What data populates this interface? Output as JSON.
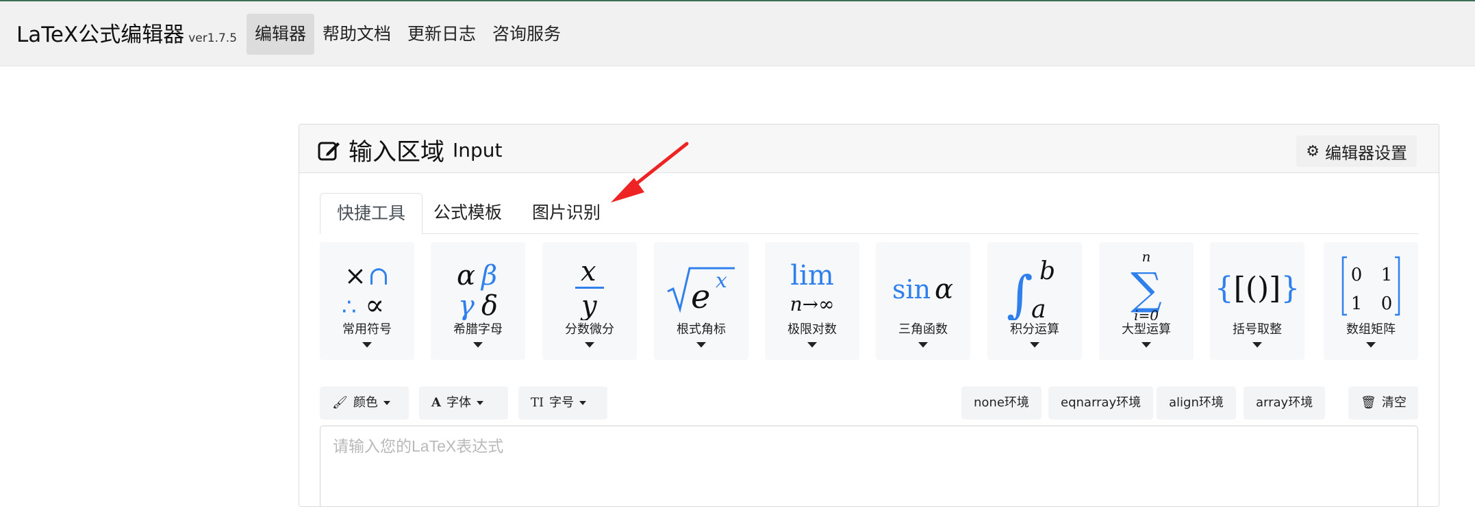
{
  "brand": {
    "name": "LaTeX公式编辑器",
    "version": "ver1.7.5"
  },
  "nav": [
    {
      "label": "编辑器",
      "active": true
    },
    {
      "label": "帮助文档",
      "active": false
    },
    {
      "label": "更新日志",
      "active": false
    },
    {
      "label": "咨询服务",
      "active": false
    }
  ],
  "card": {
    "title_cn": "输入区域",
    "title_en": "Input",
    "settings_label": "编辑器设置"
  },
  "tabs": [
    {
      "label": "快捷工具",
      "active": true
    },
    {
      "label": "公式模板",
      "active": false
    },
    {
      "label": "图片识别",
      "active": false
    }
  ],
  "tools": [
    {
      "label": "常用符号",
      "icon": "common-symbols-icon"
    },
    {
      "label": "希腊字母",
      "icon": "greek-letters-icon"
    },
    {
      "label": "分数微分",
      "icon": "fraction-icon"
    },
    {
      "label": "根式角标",
      "icon": "radical-icon"
    },
    {
      "label": "极限对数",
      "icon": "limit-icon"
    },
    {
      "label": "三角函数",
      "icon": "trig-icon"
    },
    {
      "label": "积分运算",
      "icon": "integral-icon"
    },
    {
      "label": "大型运算",
      "icon": "sum-icon"
    },
    {
      "label": "括号取整",
      "icon": "brackets-icon"
    },
    {
      "label": "数组矩阵",
      "icon": "matrix-icon"
    }
  ],
  "toolbar": {
    "color": "颜色",
    "font": "字体",
    "size": "字号",
    "envs": [
      "none环境",
      "eqnarray环境",
      "align环境",
      "array环境"
    ],
    "clear": "清空"
  },
  "editor": {
    "placeholder": "请输入您的LaTeX表达式"
  },
  "colors": {
    "accent_blue": "#2f80ed",
    "arrow_red": "#ee2424"
  }
}
